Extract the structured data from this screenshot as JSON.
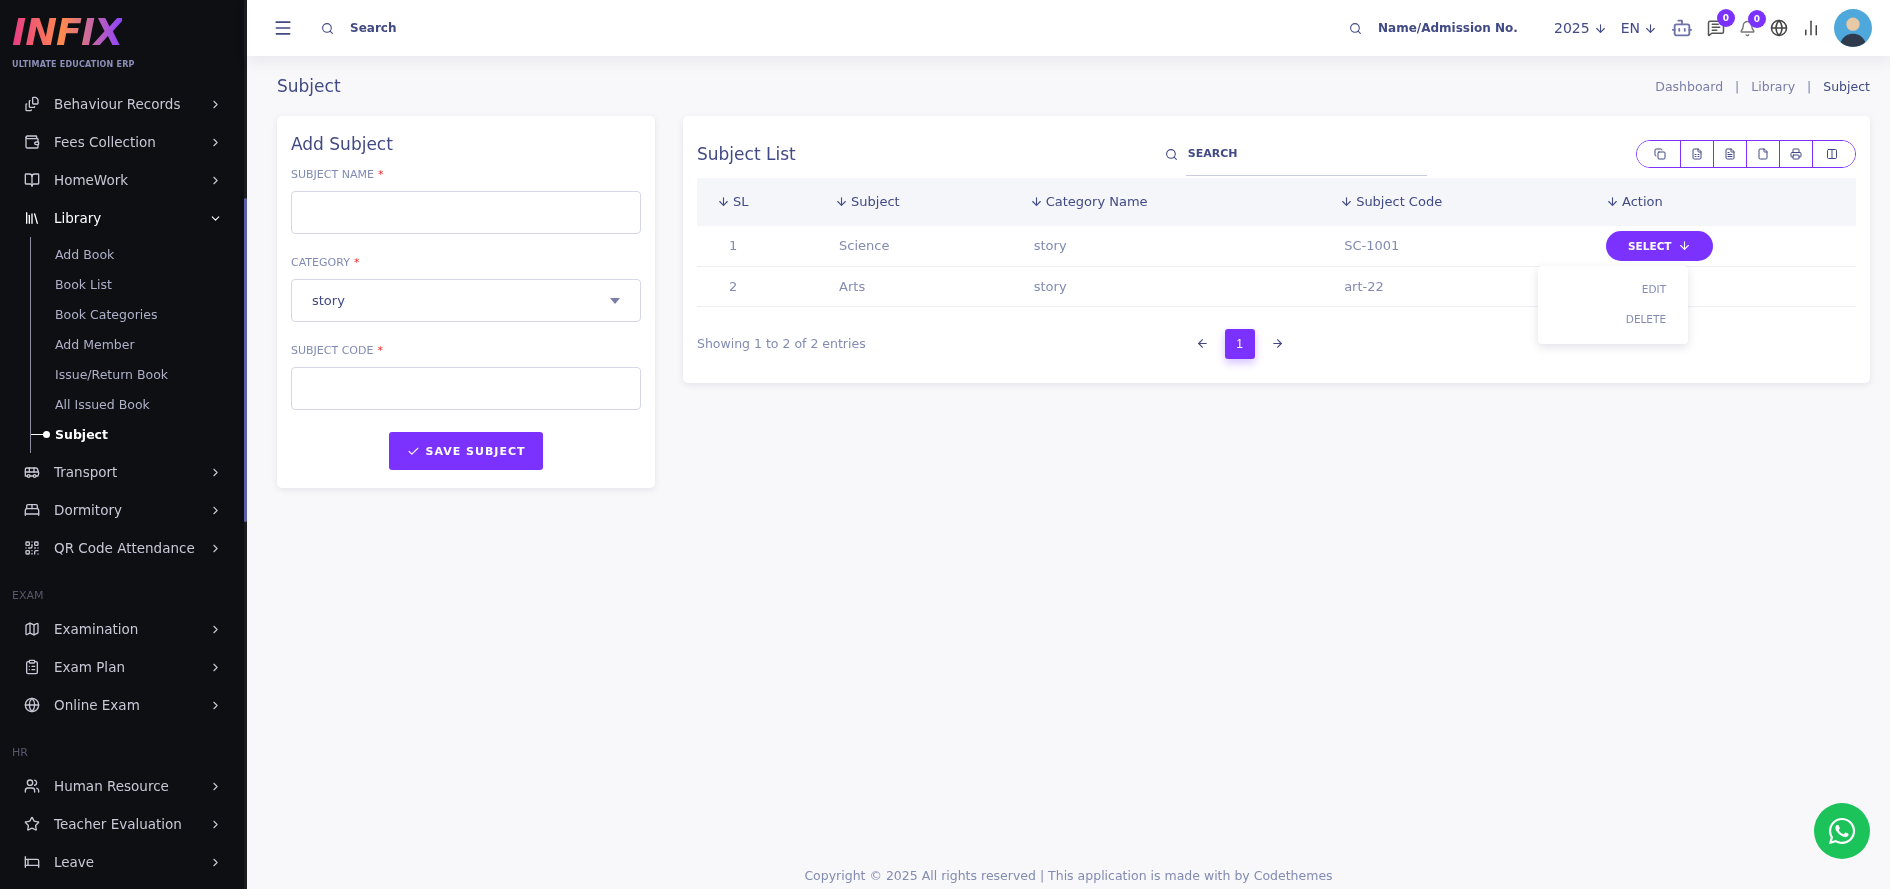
{
  "sidebar": {
    "logo": {
      "text": "INFIX",
      "tagline": "ULTIMATE EDUCATION ERP"
    },
    "sections": [
      {
        "items": [
          {
            "label": "Behaviour Records",
            "expanded": false
          },
          {
            "label": "Fees Collection",
            "expanded": false
          },
          {
            "label": "HomeWork",
            "expanded": false
          },
          {
            "label": "Library",
            "expanded": true,
            "children": [
              {
                "label": "Add Book",
                "selected": false
              },
              {
                "label": "Book List",
                "selected": false
              },
              {
                "label": "Book Categories",
                "selected": false
              },
              {
                "label": "Add Member",
                "selected": false
              },
              {
                "label": "Issue/Return Book",
                "selected": false
              },
              {
                "label": "All Issued Book",
                "selected": false
              },
              {
                "label": "Subject",
                "selected": true
              }
            ]
          },
          {
            "label": "Transport",
            "expanded": false
          },
          {
            "label": "Dormitory",
            "expanded": false
          },
          {
            "label": "QR Code Attendance",
            "expanded": false
          }
        ]
      },
      {
        "heading": "EXAM",
        "items": [
          {
            "label": "Examination",
            "expanded": false
          },
          {
            "label": "Exam Plan",
            "expanded": false
          },
          {
            "label": "Online Exam",
            "expanded": false
          }
        ]
      },
      {
        "heading": "HR",
        "items": [
          {
            "label": "Human Resource",
            "expanded": false
          },
          {
            "label": "Teacher Evaluation",
            "expanded": false
          },
          {
            "label": "Leave",
            "expanded": false
          }
        ]
      }
    ]
  },
  "topbar": {
    "search": {
      "placeholder": "Search"
    },
    "student_search": {
      "placeholder": "Name/Admission No."
    },
    "year": "2025",
    "language": "EN",
    "message_count": "0",
    "notification_count": "0"
  },
  "page": {
    "title": "Subject",
    "breadcrumb": [
      "Dashboard",
      "Library",
      "Subject"
    ],
    "breadcrumb_separator": "|"
  },
  "form": {
    "title": "Add Subject",
    "fields": [
      {
        "kind": "text",
        "label": "SUBJECT NAME",
        "required_mark": "*"
      },
      {
        "kind": "select",
        "label": "CATEGORY",
        "required_mark": "*",
        "value": "story"
      },
      {
        "kind": "text",
        "label": "SUBJECT CODE",
        "required_mark": "*"
      }
    ],
    "submit": "SAVE SUBJECT"
  },
  "list": {
    "title": "Subject List",
    "search": {
      "placeholder": "SEARCH"
    },
    "columns": [
      "SL",
      "Subject",
      "Category Name",
      "Subject Code",
      "Action"
    ],
    "rows": [
      {
        "cells": [
          "1",
          "Science",
          "story",
          "SC-1001"
        ],
        "action": {
          "label": "SELECT",
          "menu_open": true,
          "menu": [
            "EDIT",
            "DELETE"
          ]
        }
      },
      {
        "cells": [
          "2",
          "Arts",
          "story",
          "art-22"
        ]
      }
    ],
    "info": "Showing 1 to 2 of 2 entries",
    "pages": [
      {
        "label": "1",
        "selected": true
      }
    ]
  },
  "footer": "Copyright © 2025 All rights reserved | This application is made with by Codethemes"
}
